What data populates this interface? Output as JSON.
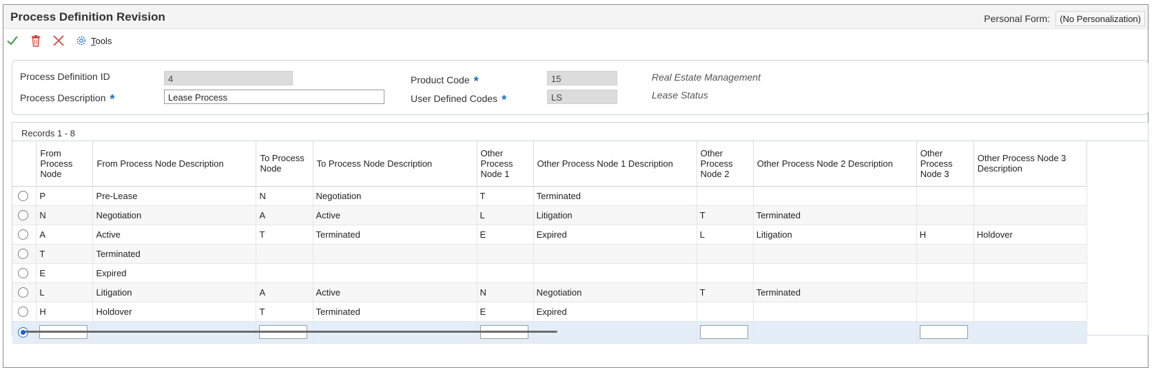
{
  "window": {
    "title": "Process Definition Revision",
    "personal_form_label": "Personal Form:",
    "personal_form_value": "(No Personalization)"
  },
  "toolbar": {
    "ok_icon": "checkmark-icon",
    "delete_icon": "trash-icon",
    "cancel_icon": "close-icon",
    "tools_icon": "gear-icon",
    "tools_label_underlined": "T",
    "tools_label_rest": "ools"
  },
  "header": {
    "process_definition_id_label": "Process Definition ID",
    "process_definition_id_value": "4",
    "process_description_label": "Process Description",
    "process_description_value": "Lease Process",
    "product_code_label": "Product Code",
    "product_code_value": "15",
    "product_code_desc": "Real Estate Management",
    "user_defined_codes_label": "User Defined Codes",
    "user_defined_codes_value": "LS",
    "user_defined_codes_desc": "Lease Status",
    "required_marker": "*"
  },
  "grid": {
    "records_label": "Records 1 - 8",
    "columns": [
      "From Process Node",
      "From Process Node Description",
      "To Process Node",
      "To Process Node Description",
      "Other Process Node 1",
      "Other Process Node 1 Description",
      "Other Process Node 2",
      "Other Process Node 2 Description",
      "Other Process Node 3",
      "Other Process Node 3 Description"
    ],
    "rows": [
      [
        "P",
        "Pre-Lease",
        "N",
        "Negotiation",
        "T",
        "Terminated",
        "",
        "",
        "",
        ""
      ],
      [
        "N",
        "Negotiation",
        "A",
        "Active",
        "L",
        "Litigation",
        "T",
        "Terminated",
        "",
        ""
      ],
      [
        "A",
        "Active",
        "T",
        "Terminated",
        "E",
        "Expired",
        "L",
        "Litigation",
        "H",
        "Holdover"
      ],
      [
        "T",
        "Terminated",
        "",
        "",
        "",
        "",
        "",
        "",
        "",
        ""
      ],
      [
        "E",
        "Expired",
        "",
        "",
        "",
        "",
        "",
        "",
        "",
        ""
      ],
      [
        "L",
        "Litigation",
        "A",
        "Active",
        "N",
        "Negotiation",
        "T",
        "Terminated",
        "",
        ""
      ],
      [
        "H",
        "Holdover",
        "T",
        "Terminated",
        "E",
        "Expired",
        "",
        "",
        "",
        ""
      ]
    ]
  },
  "colors": {
    "required_marker": "#1a6ec5",
    "ok_icon": "#3b9c3b",
    "delete_icon": "#d9433a",
    "cancel_icon": "#d9433a",
    "tools_icon": "#2a78c8",
    "selected_row": "#e3eef9"
  }
}
